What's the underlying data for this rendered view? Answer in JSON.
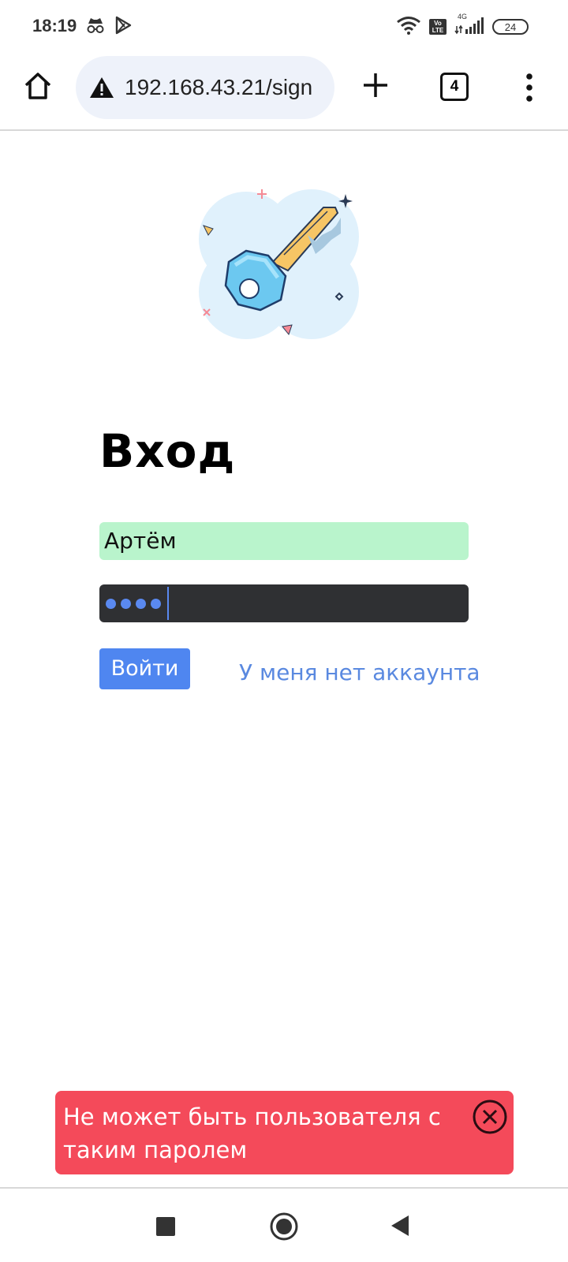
{
  "status_bar": {
    "time": "18:19",
    "battery": "24",
    "network": "4G",
    "volte": "Vo LTE",
    "icons": [
      "incognito-icon",
      "play-store-icon",
      "wifi-icon",
      "signal-icon"
    ]
  },
  "browser": {
    "url": "192.168.43.21/sign",
    "tab_count": "4",
    "icons": [
      "home-icon",
      "warning-icon",
      "plus-icon",
      "more-vert-icon"
    ]
  },
  "page": {
    "title": "Вход",
    "illustration": "key-icon",
    "login_value": "Артём",
    "password_dots": 4,
    "login_button": "Войти",
    "register_link": "У меня нет аккаунта"
  },
  "toast": {
    "message": "Не может быть пользователя с таким паролем",
    "close_icon": "close-circle-icon"
  },
  "nav": {
    "icons": [
      "recents-icon",
      "home-circle-icon",
      "back-triangle-icon"
    ]
  },
  "colors": {
    "input_valid_bg": "#b9f4cc",
    "input_dark_bg": "#2f3033",
    "primary": "#4f86f0",
    "link": "#5a89e0",
    "error": "#f44a5a"
  }
}
